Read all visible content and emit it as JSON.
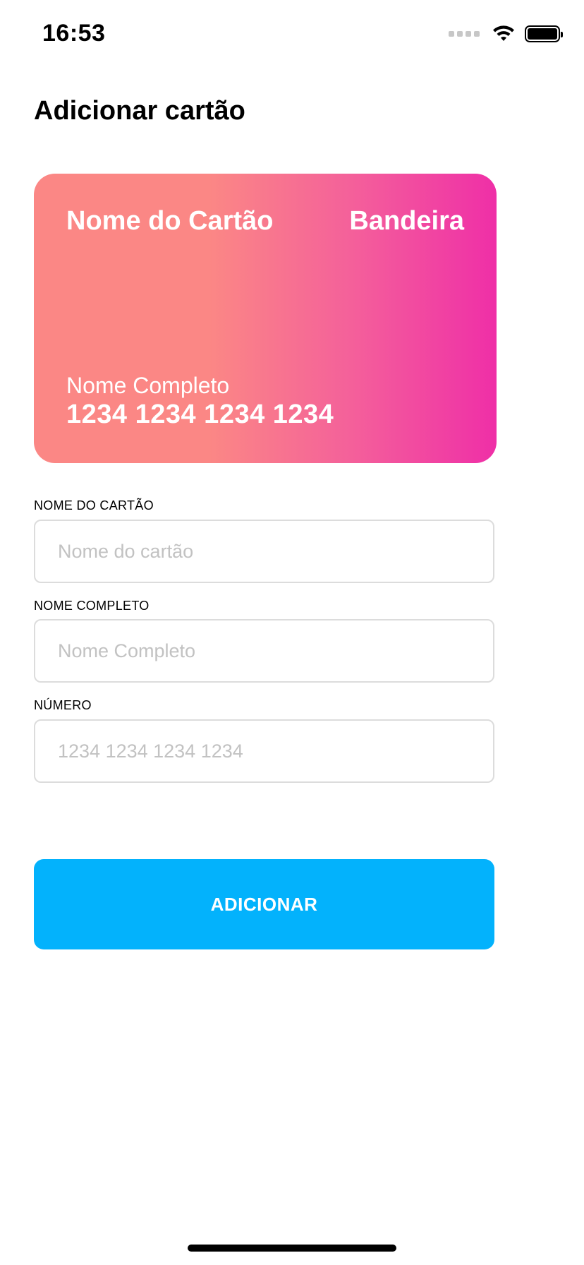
{
  "status_bar": {
    "time": "16:53",
    "icons": [
      "cellular-signal-icon",
      "wifi-icon",
      "battery-icon"
    ]
  },
  "page": {
    "title": "Adicionar cartão"
  },
  "card_preview": {
    "name": "Nome do Cartão",
    "brand": "Bandeira",
    "holder": "Nome Completo",
    "number": "1234 1234 1234 1234",
    "gradient_colors": [
      "#fb8785",
      "#f4619a",
      "#ef2fa7"
    ]
  },
  "form": {
    "card_name": {
      "label": "NOME DO CARTÃO",
      "value": "",
      "placeholder": "Nome do cartão"
    },
    "full_name": {
      "label": "NOME COMPLETO",
      "value": "",
      "placeholder": "Nome Completo"
    },
    "number": {
      "label": "NÚMERO",
      "value": "",
      "placeholder": "1234 1234 1234 1234"
    }
  },
  "actions": {
    "add_label": "ADICIONAR",
    "add_color": "#03b2fc"
  }
}
